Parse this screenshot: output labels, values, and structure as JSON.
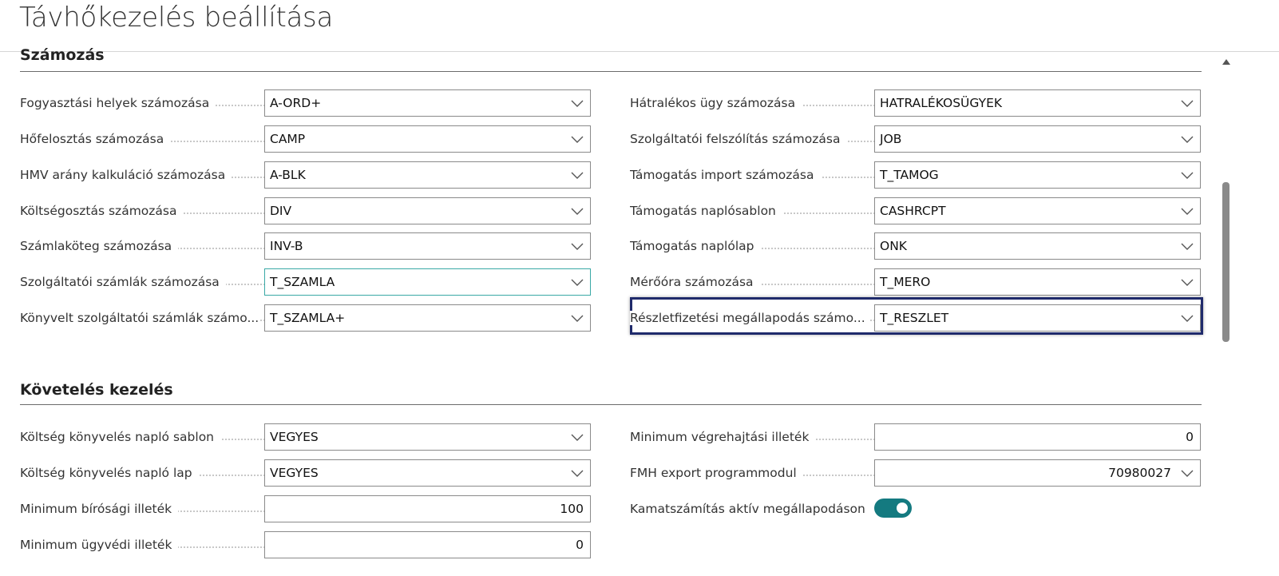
{
  "page": {
    "title": "Távhőkezelés beállítása"
  },
  "numbering": {
    "title": "Számozás",
    "left_fields": [
      {
        "label": "Fogyasztási helyek számozása",
        "value": "A-ORD+"
      },
      {
        "label": "Hőfelosztás számozása",
        "value": "CAMP"
      },
      {
        "label": "HMV arány kalkuláció számozása",
        "value": "A-BLK"
      },
      {
        "label": "Költségosztás számozása",
        "value": "DIV"
      },
      {
        "label": "Számlaköteg számozása",
        "value": "INV-B"
      },
      {
        "label": "Szolgáltatói számlák számozása",
        "value": "T_SZAMLA"
      },
      {
        "label": "Könyvelt szolgáltatói számlák számo...",
        "value": "T_SZAMLA+"
      }
    ],
    "right_fields": [
      {
        "label": "Hátralékos ügy számozása",
        "value": "HATRALÉKOSÜGYEK"
      },
      {
        "label": "Szolgáltatói felszólítás számozása",
        "value": "JOB"
      },
      {
        "label": "Támogatás import számozása",
        "value": "T_TAMOG"
      },
      {
        "label": "Támogatás naplósablon",
        "value": "CASHRCPT"
      },
      {
        "label": "Támogatás naplólap",
        "value": "ONK"
      },
      {
        "label": "Mérőóra számozása",
        "value": "T_MERO"
      },
      {
        "label": "Részletfizetési megállapodás számo...",
        "value": "T_RESZLET"
      }
    ]
  },
  "claims": {
    "title": "Követelés kezelés",
    "left_fields": [
      {
        "label": "Költség könyvelés napló sablon",
        "value": "VEGYES"
      },
      {
        "label": "Költség könyvelés napló lap",
        "value": "VEGYES"
      },
      {
        "label": "Minimum bírósági illeték",
        "value": "100"
      },
      {
        "label": "Minimum ügyvédi illeték",
        "value": "0"
      }
    ],
    "right_fields": [
      {
        "label": "Minimum végrehajtási illeték",
        "value": "0"
      },
      {
        "label": "FMH export programmodul",
        "value": "70980027"
      },
      {
        "label": "Kamatszámítás aktív megállapodáson",
        "value": "on"
      }
    ]
  },
  "colors": {
    "accent": "#147a80",
    "focus": "#3aa9a6",
    "highlight": "#1f2a6b"
  }
}
